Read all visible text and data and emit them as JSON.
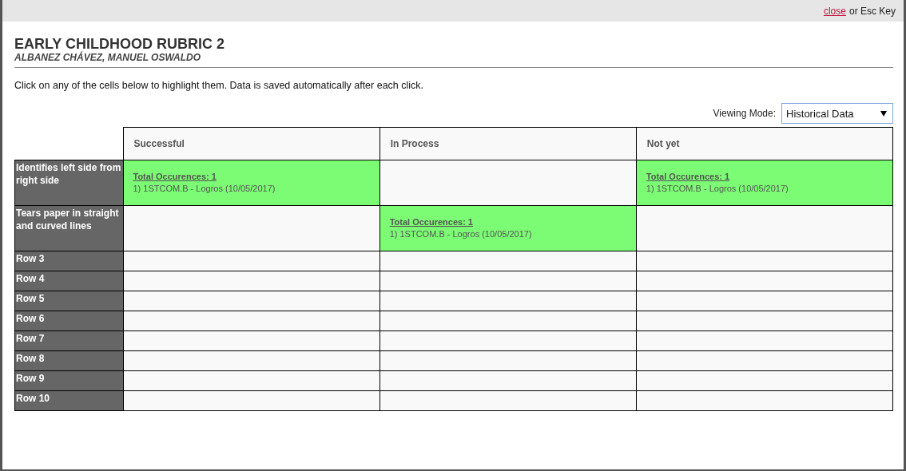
{
  "top_bar": {
    "close_link": "close",
    "close_hint": "or Esc Key"
  },
  "title": "EARLY CHILDHOOD RUBRIC 2",
  "student": "ALBANEZ CHÁVEZ, MANUEL OSWALDO",
  "instructions": "Click on any of the cells below to highlight them. Data is saved automatically after each click.",
  "viewing_mode": {
    "label": "Viewing Mode:",
    "value": "Historical Data"
  },
  "table": {
    "columns": [
      "Successful",
      "In Process",
      "Not yet"
    ],
    "rows": [
      {
        "label": "Identifies left side from right side",
        "cells": [
          {
            "selected": true,
            "total": "Total Occurences: 1",
            "entries": [
              "1) 1STCOM.B - Logros (10/05/2017)"
            ]
          },
          {
            "selected": false
          },
          {
            "selected": true,
            "total": "Total Occurences: 1",
            "entries": [
              "1) 1STCOM.B - Logros (10/05/2017)"
            ]
          }
        ]
      },
      {
        "label": "Tears paper in straight and curved lines",
        "cells": [
          {
            "selected": false
          },
          {
            "selected": true,
            "total": "Total Occurences: 1",
            "entries": [
              "1) 1STCOM.B - Logros (10/05/2017)"
            ]
          },
          {
            "selected": false
          }
        ]
      },
      {
        "label": "Row 3",
        "cells": [
          {
            "selected": false
          },
          {
            "selected": false
          },
          {
            "selected": false
          }
        ]
      },
      {
        "label": "Row 4",
        "cells": [
          {
            "selected": false
          },
          {
            "selected": false
          },
          {
            "selected": false
          }
        ]
      },
      {
        "label": "Row 5",
        "cells": [
          {
            "selected": false
          },
          {
            "selected": false
          },
          {
            "selected": false
          }
        ]
      },
      {
        "label": "Row 6",
        "cells": [
          {
            "selected": false
          },
          {
            "selected": false
          },
          {
            "selected": false
          }
        ]
      },
      {
        "label": "Row 7",
        "cells": [
          {
            "selected": false
          },
          {
            "selected": false
          },
          {
            "selected": false
          }
        ]
      },
      {
        "label": "Row 8",
        "cells": [
          {
            "selected": false
          },
          {
            "selected": false
          },
          {
            "selected": false
          }
        ]
      },
      {
        "label": "Row 9",
        "cells": [
          {
            "selected": false
          },
          {
            "selected": false
          },
          {
            "selected": false
          }
        ]
      },
      {
        "label": "Row 10",
        "cells": [
          {
            "selected": false
          },
          {
            "selected": false
          },
          {
            "selected": false
          }
        ]
      }
    ]
  }
}
